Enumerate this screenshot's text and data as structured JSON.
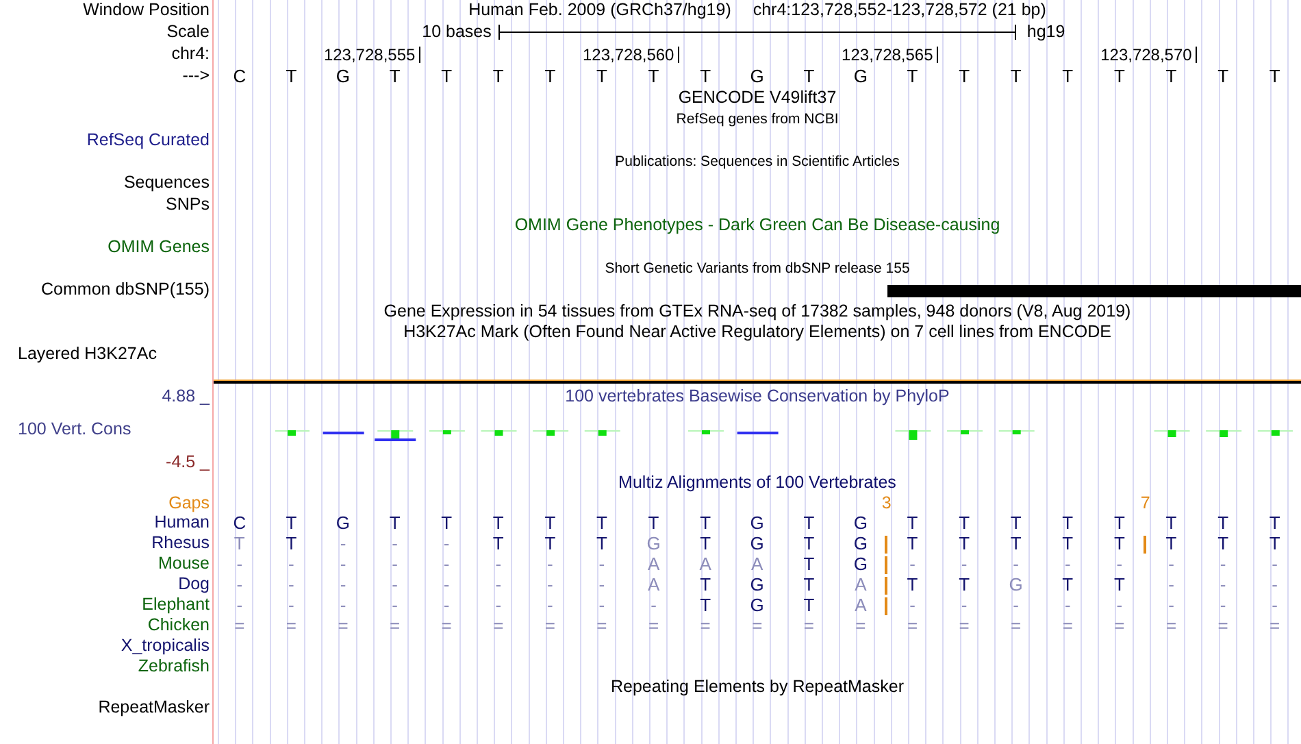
{
  "header": {
    "label": "Window Position",
    "assembly": "Human Feb. 2009 (GRCh37/hg19)",
    "position": "chr4:123,728,552-123,728,572 (21 bp)"
  },
  "scale": {
    "label": "Scale",
    "length": "10 bases",
    "assembly": "hg19"
  },
  "coordinates": {
    "label": "chr4:",
    "ticks": [
      "123,728,555",
      "123,728,560",
      "123,728,565",
      "123,728,570"
    ]
  },
  "sequence": {
    "label": "--->",
    "bases": [
      "C",
      "T",
      "G",
      "T",
      "T",
      "T",
      "T",
      "T",
      "T",
      "T",
      "G",
      "T",
      "G",
      "T",
      "T",
      "T",
      "T",
      "T",
      "T",
      "T",
      "T"
    ]
  },
  "track_rows": [
    {
      "kind": "title",
      "text": "GENCODE V49lift37",
      "color": "#000000"
    },
    {
      "kind": "subtitle",
      "text": "RefSeq genes from NCBI",
      "color": "#000000"
    },
    {
      "kind": "label",
      "text": "RefSeq Curated",
      "color": "#20208c"
    },
    {
      "kind": "subtitle",
      "text": "Publications: Sequences in Scientific Articles",
      "color": "#000000"
    },
    {
      "kind": "label",
      "text": "Sequences",
      "color": "#000000"
    },
    {
      "kind": "label",
      "text": "SNPs",
      "color": "#000000"
    },
    {
      "kind": "title",
      "text": "OMIM Gene Phenotypes - Dark Green Can Be Disease-causing",
      "color": "#0c640c"
    },
    {
      "kind": "label",
      "text": "OMIM Genes",
      "color": "#0c640c"
    },
    {
      "kind": "subtitle",
      "text": "Short Genetic Variants from dbSNP release 155",
      "color": "#000000"
    },
    {
      "kind": "feature_label",
      "text": "Common dbSNP(155)",
      "color": "#000000"
    },
    {
      "kind": "title",
      "text": "Gene Expression in 54 tissues from GTEx RNA-seq of 17382 samples, 948 donors (V8, Aug 2019)",
      "color": "#000000"
    },
    {
      "kind": "title",
      "text": "H3K27Ac Mark (Often Found Near Active Regulatory Elements) on 7 cell lines from ENCODE",
      "color": "#000000"
    },
    {
      "kind": "left_label",
      "text": "Layered H3K27Ac",
      "color": "#000000"
    }
  ],
  "conservation": {
    "title": "100 vertebrates Basewise Conservation by PhyloP",
    "label": "100 Vert. Cons",
    "max": "4.88 _",
    "min": "-4.5 _"
  },
  "alignment": {
    "title": "Multiz Alignments of 100 Vertebrates",
    "gaps": {
      "label": "Gaps",
      "cells": [
        null,
        null,
        null,
        null,
        null,
        null,
        null,
        null,
        null,
        null,
        null,
        null,
        null,
        {
          "kind": "insertion",
          "text": "3"
        },
        null,
        null,
        null,
        null,
        null,
        {
          "kind": "insertion",
          "text": "7"
        },
        null,
        null,
        null
      ]
    },
    "species": [
      {
        "name": "Human",
        "color": "#14146e",
        "cells": [
          "C",
          "T",
          "G",
          "T",
          "T",
          "T",
          "T",
          "T",
          "T",
          "T",
          "G",
          "T",
          "G",
          "T",
          "T",
          "T",
          "T",
          "T",
          "T",
          "T",
          "T"
        ]
      },
      {
        "name": "Rhesus",
        "color": "#14146e",
        "cells": [
          "T",
          "T",
          "-",
          "-",
          "-",
          "T",
          "T",
          "T",
          "G",
          "T",
          "G",
          "T",
          "G",
          {
            "kind": "insertion"
          },
          "T",
          "T",
          "T",
          "T",
          "T",
          {
            "kind": "insertion"
          },
          "T",
          "T",
          "T"
        ]
      },
      {
        "name": "Mouse",
        "color": "#0c640c",
        "cells": [
          "-",
          "-",
          "-",
          "-",
          "-",
          "-",
          "-",
          "-",
          "A",
          "A",
          "A",
          "T",
          "G",
          {
            "kind": "insertion"
          },
          "-",
          "-",
          "-",
          "-",
          "-",
          "-",
          "-",
          "-"
        ]
      },
      {
        "name": "Dog",
        "color": "#14146e",
        "cells": [
          "-",
          "-",
          "-",
          "-",
          "-",
          "-",
          "-",
          "-",
          "A",
          "T",
          "G",
          "T",
          "A",
          {
            "kind": "insertion"
          },
          "T",
          "T",
          "G",
          "T",
          "T",
          "-",
          "-",
          "-"
        ]
      },
      {
        "name": "Elephant",
        "color": "#0c640c",
        "cells": [
          "-",
          "-",
          "-",
          "-",
          "-",
          "-",
          "-",
          "-",
          "-",
          "T",
          "G",
          "T",
          "A",
          {
            "kind": "insertion"
          },
          "-",
          "-",
          "-",
          "-",
          "-",
          "-",
          "-",
          "-"
        ]
      },
      {
        "name": "Chicken",
        "color": "#0c640c",
        "cells": [
          "=",
          "=",
          "=",
          "=",
          "=",
          "=",
          "=",
          "=",
          "=",
          "=",
          "=",
          "=",
          "=",
          "=",
          "=",
          "=",
          "=",
          "=",
          "=",
          "=",
          "="
        ]
      },
      {
        "name": "X_tropicalis",
        "color": "#14146e"
      },
      {
        "name": "Zebrafish",
        "color": "#0c640c"
      }
    ]
  },
  "repeats": {
    "title": "Repeating Elements by RepeatMasker",
    "label": "RepeatMasker"
  }
}
